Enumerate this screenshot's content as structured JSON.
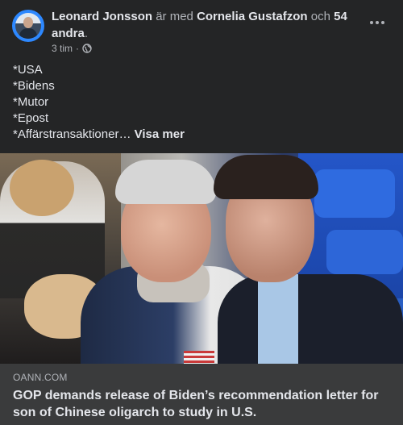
{
  "post": {
    "author": "Leonard Jonsson",
    "with_text": "är med",
    "tagged_person": "Cornelia Gustafzon",
    "and_text": "och",
    "others": "54 andra",
    "period": ".",
    "time": "3 tim",
    "separator": "·",
    "privacy_icon": "globe-icon",
    "more_icon": "more-dots-icon",
    "text_lines": [
      "*USA",
      "*Bidens",
      "*Mutor",
      "*Epost",
      "*Affärstransaktioner…"
    ],
    "see_more": "Visa mer"
  },
  "link": {
    "domain": "OANN.COM",
    "title": "GOP demands release of Biden’s recommendation letter for son of Chinese oligarch to study in U.S."
  }
}
